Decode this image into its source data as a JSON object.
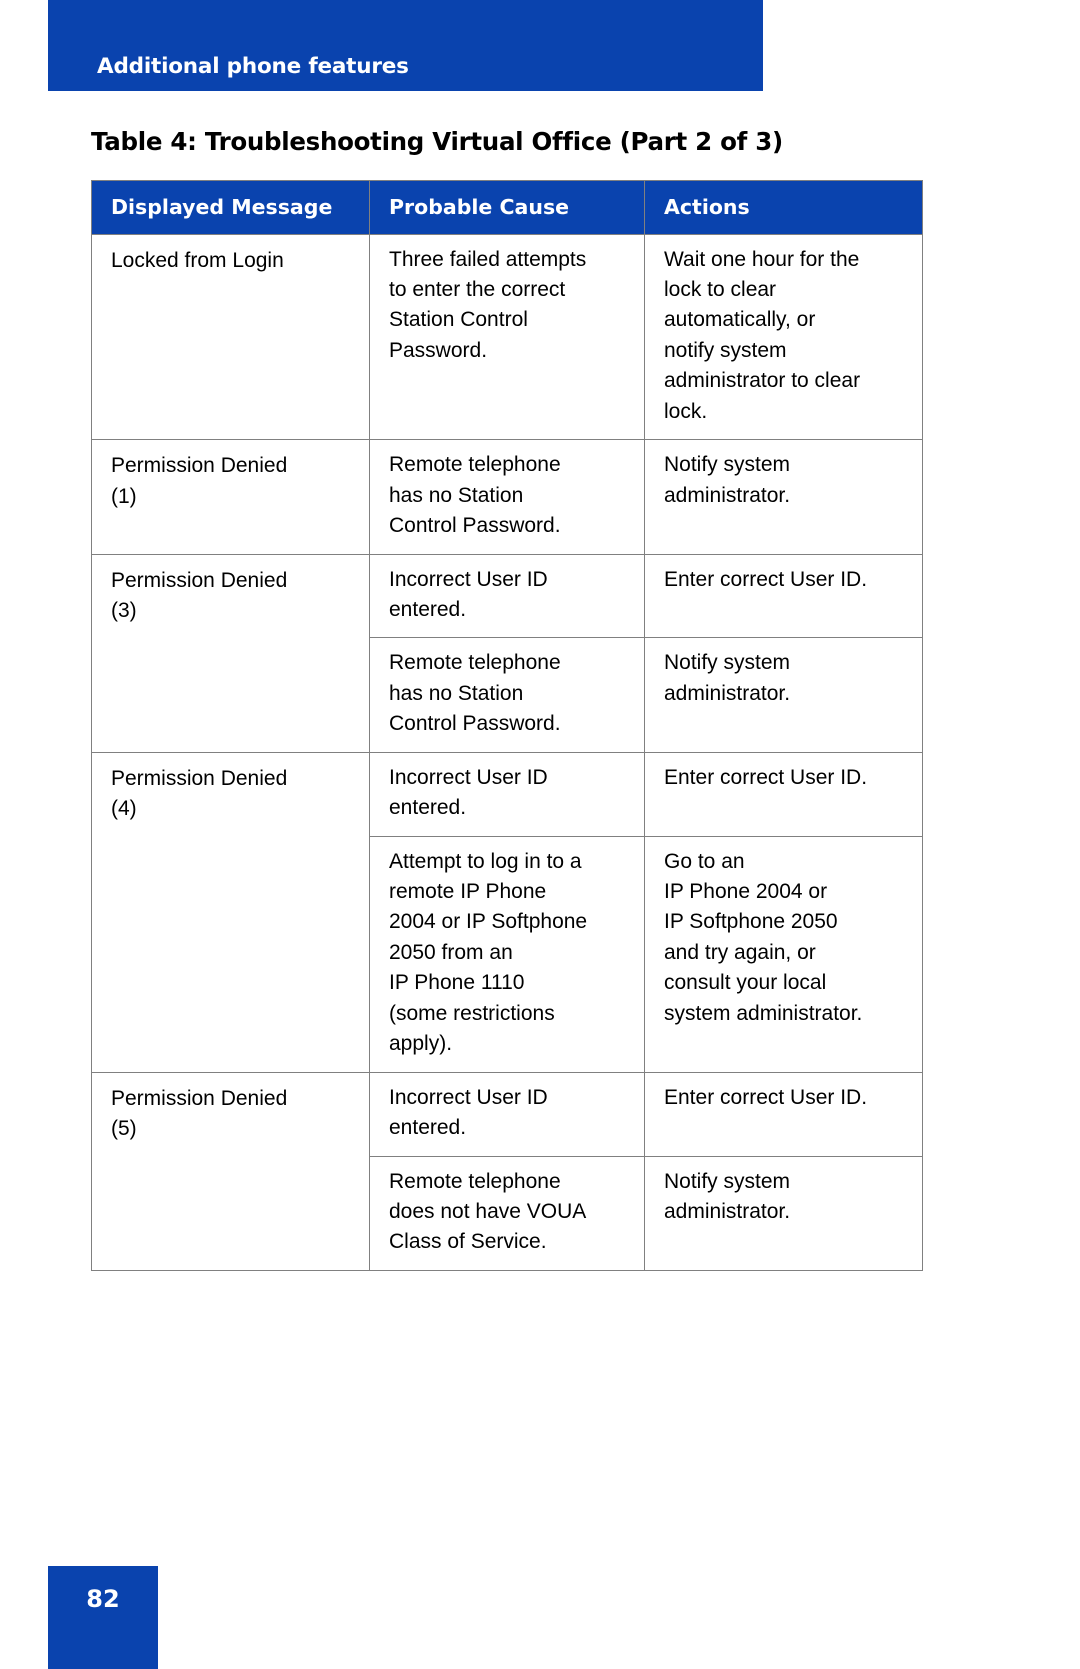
{
  "colors": {
    "brand_blue": "#0a43ae",
    "border_gray": "#808080",
    "text_black": "#000000",
    "text_white": "#ffffff"
  },
  "header": {
    "title": "Additional phone features"
  },
  "table_caption": "Table 4: Troubleshooting Virtual Office (Part 2 of 3)",
  "table": {
    "columns": [
      "Displayed Message",
      "Probable Cause",
      "Actions"
    ],
    "groups": [
      {
        "message": "Locked from Login",
        "rows": [
          {
            "cause": "Three failed attempts to enter the correct Station Control Password.",
            "cause_lines": [
              "Three failed attempts",
              "to enter the correct",
              "Station Control",
              "Password."
            ],
            "action": "Wait one hour for the lock to clear automatically, or notify system administrator to clear lock.",
            "action_lines": [
              "Wait one hour for the",
              "lock to clear",
              "automatically, or",
              "notify system",
              "administrator to clear",
              "lock."
            ]
          }
        ]
      },
      {
        "message": "Permission Denied (1)",
        "message_lines": [
          "Permission Denied",
          "(1)"
        ],
        "rows": [
          {
            "cause": "Remote telephone has no Station Control Password.",
            "cause_lines": [
              "Remote telephone",
              "has no Station",
              "Control Password."
            ],
            "action": "Notify system administrator.",
            "action_lines": [
              "Notify system",
              "administrator."
            ]
          }
        ]
      },
      {
        "message": "Permission Denied (3)",
        "message_lines": [
          "Permission Denied",
          "(3)"
        ],
        "rows": [
          {
            "cause": "Incorrect User ID entered.",
            "cause_lines": [
              "Incorrect User ID",
              "entered."
            ],
            "action": "Enter correct User ID.",
            "action_lines": [
              "Enter correct User ID."
            ]
          },
          {
            "cause": "Remote telephone has no Station Control Password.",
            "cause_lines": [
              "Remote telephone",
              "has no Station",
              "Control Password."
            ],
            "action": "Notify system administrator.",
            "action_lines": [
              "Notify system",
              "administrator."
            ]
          }
        ]
      },
      {
        "message": "Permission Denied (4)",
        "message_lines": [
          "Permission Denied",
          "(4)"
        ],
        "rows": [
          {
            "cause": "Incorrect User ID entered.",
            "cause_lines": [
              "Incorrect User ID",
              "entered."
            ],
            "action": "Enter correct User ID.",
            "action_lines": [
              "Enter correct User ID."
            ]
          },
          {
            "cause": "Attempt to log in to a remote IP Phone 2004 or IP Softphone 2050 from an IP Phone 1110 (some restrictions apply).",
            "cause_lines": [
              "Attempt to log in to a",
              "remote IP Phone",
              "2004 or IP Softphone",
              "2050 from an",
              "IP Phone 1110",
              "(some restrictions",
              "apply)."
            ],
            "action": "Go to an IP Phone 2004 or IP Softphone 2050 and try again, or consult your local system administrator.",
            "action_lines": [
              "Go to an",
              "IP Phone 2004 or",
              "IP Softphone 2050",
              "and try again, or",
              "consult your local",
              "system administrator."
            ]
          }
        ]
      },
      {
        "message": "Permission Denied (5)",
        "message_lines": [
          "Permission Denied",
          "(5)"
        ],
        "rows": [
          {
            "cause": "Incorrect User ID entered.",
            "cause_lines": [
              "Incorrect User ID",
              "entered."
            ],
            "action": "Enter correct User ID.",
            "action_lines": [
              "Enter correct User ID."
            ]
          },
          {
            "cause": "Remote telephone does not have VOUA Class of Service.",
            "cause_lines": [
              "Remote telephone",
              "does not have VOUA",
              "Class of Service."
            ],
            "action": "Notify system administrator.",
            "action_lines": [
              "Notify system",
              "administrator."
            ]
          }
        ]
      }
    ]
  },
  "footer": {
    "page_number": "82"
  }
}
